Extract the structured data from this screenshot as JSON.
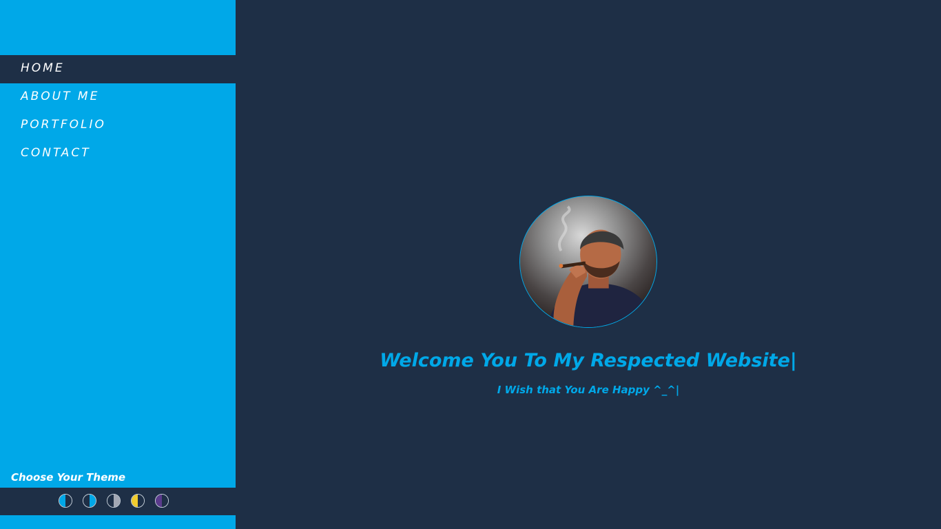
{
  "sidebar": {
    "nav": [
      {
        "label": "HOME",
        "active": true
      },
      {
        "label": "ABOUT ME",
        "active": false
      },
      {
        "label": "PORTFOLIO",
        "active": false
      },
      {
        "label": "CONTACT",
        "active": false
      }
    ],
    "theme_label": "Choose Your Theme",
    "themes": [
      {
        "left": "#00a8e8",
        "right": "#1e2f46"
      },
      {
        "left": "#1e2f46",
        "right": "#00a8e8"
      },
      {
        "left": "#1e2f46",
        "right": "#a3a8b4"
      },
      {
        "left": "#f2cd2e",
        "right": "#1e2f46"
      },
      {
        "left": "#5a3b8c",
        "right": "#1e2f46"
      }
    ]
  },
  "main": {
    "avatar_alt": "portrait-illustration",
    "welcome": "Welcome You To My Respected Website|",
    "subtitle": "I Wish that You Are Happy ^_^|"
  },
  "colors": {
    "accent": "#00a8e8",
    "background": "#1e2f46"
  }
}
